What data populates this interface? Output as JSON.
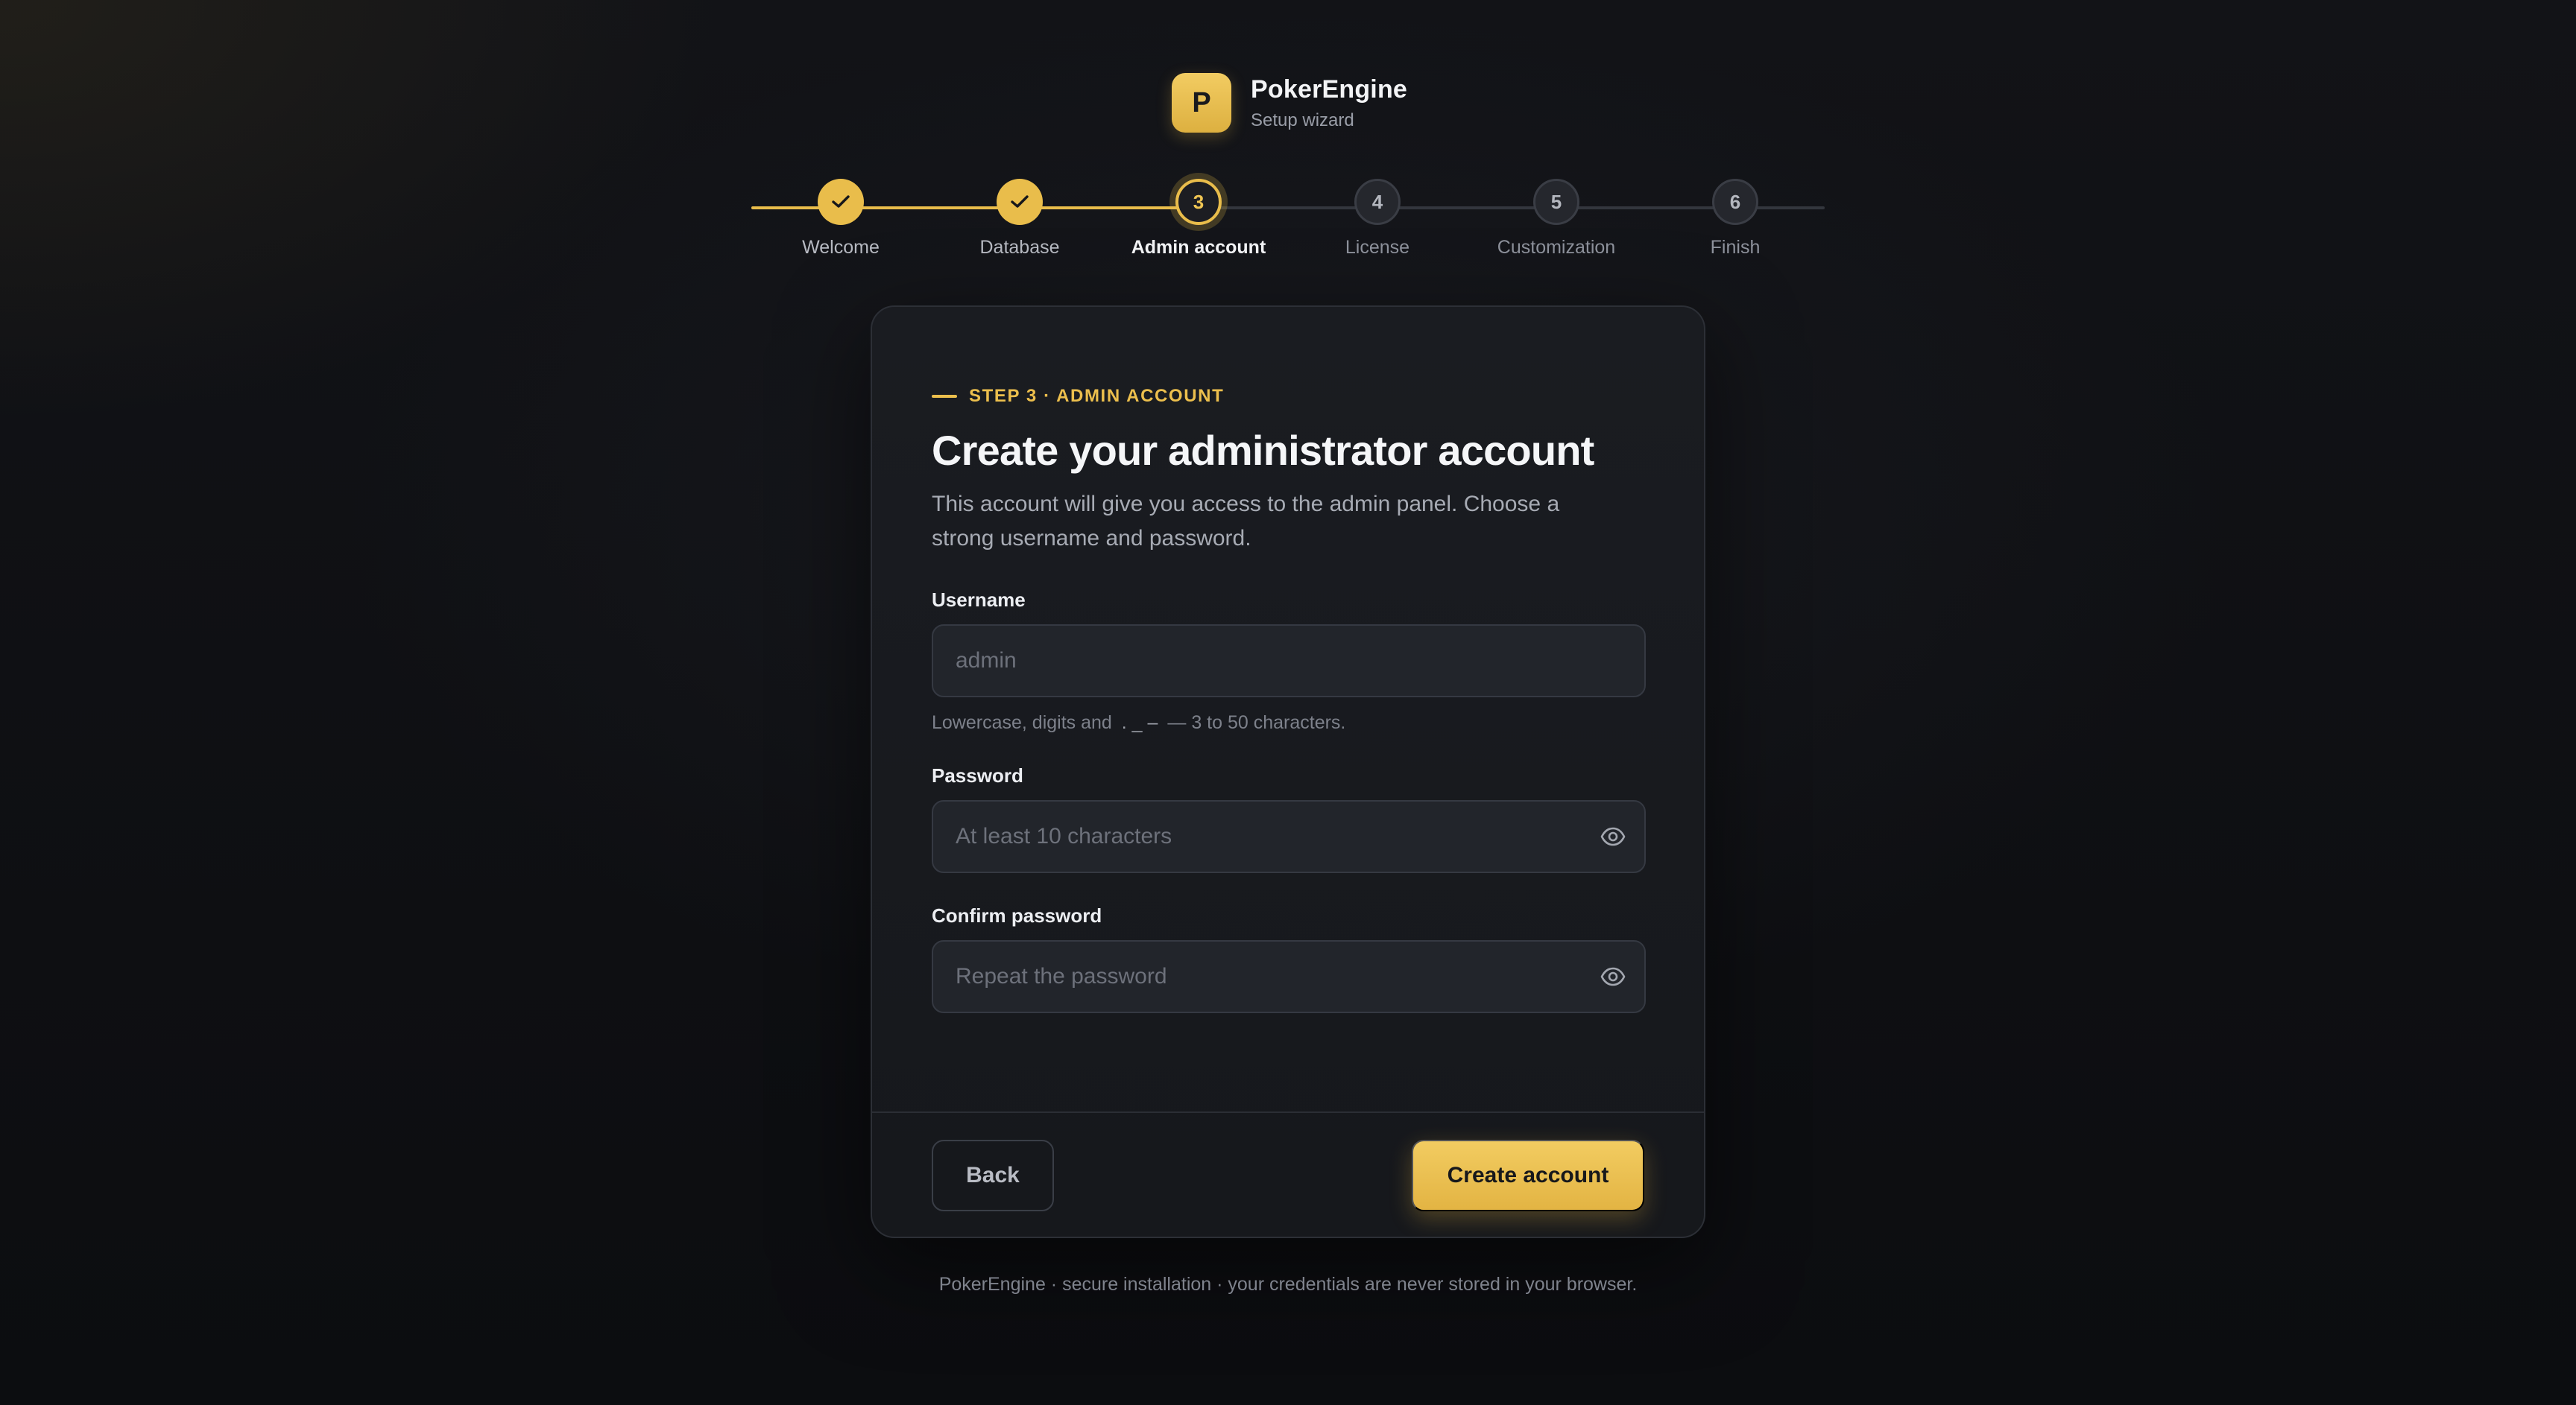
{
  "brand": {
    "logo_letter": "P",
    "name": "PokerEngine",
    "subtitle": "Setup wizard"
  },
  "stepper": {
    "steps": [
      {
        "label": "Welcome",
        "number": "1",
        "state": "done"
      },
      {
        "label": "Database",
        "number": "2",
        "state": "done"
      },
      {
        "label": "Admin account",
        "number": "3",
        "state": "current"
      },
      {
        "label": "License",
        "number": "4",
        "state": "todo"
      },
      {
        "label": "Customization",
        "number": "5",
        "state": "todo"
      },
      {
        "label": "Finish",
        "number": "6",
        "state": "todo"
      }
    ]
  },
  "card": {
    "eyebrow": "STEP 3 · ADMIN ACCOUNT",
    "title": "Create your administrator account",
    "description": "This account will give you access to the admin panel. Choose a strong username and password.",
    "username": {
      "label": "Username",
      "value": "",
      "placeholder": "admin",
      "hint_prefix": "Lowercase, digits and",
      "hint_chars": ". _ –",
      "hint_suffix": "— 3 to 50 characters."
    },
    "password": {
      "label": "Password",
      "value": "",
      "placeholder": "At least 10 characters"
    },
    "confirm_password": {
      "label": "Confirm password",
      "value": "",
      "placeholder": "Repeat the password"
    },
    "back_label": "Back",
    "submit_label": "Create account"
  },
  "footer_note": "PokerEngine · secure installation · your credentials are never stored in your browser.",
  "colors": {
    "accent": "#e9bd4b",
    "background": "#0f1013",
    "card": "#1a1c21"
  },
  "icons": {
    "check": "check-icon",
    "show_password": "eye-icon"
  }
}
